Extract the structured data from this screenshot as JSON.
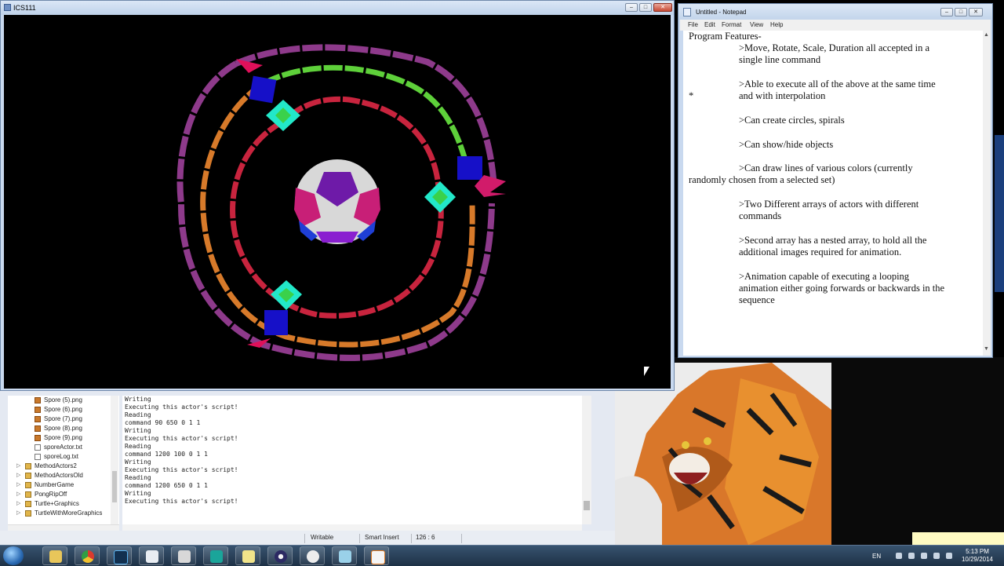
{
  "ics_window": {
    "title": "ICS111"
  },
  "notepad": {
    "title": "Untitled - Notepad",
    "menu": [
      "File",
      "Edit",
      "Format",
      "View",
      "Help"
    ],
    "lines": [
      "Program Features-",
      ">Move, Rotate, Scale, Duration all accepted in a",
      "single line command",
      ">Able to execute all of the above at the same time",
      "*",
      "and with interpolation",
      ">Can create circles, spirals",
      ">Can show/hide objects",
      ">Can draw lines of various colors (currently",
      "randomly chosen from a selected set)",
      ">Two Different arrays of actors with different",
      "commands",
      ">Second array has a nested array, to hold all the",
      "additional images required for animation.",
      ">Animation capable of executing a looping",
      "animation either going forwards or backwards in the",
      "sequence"
    ]
  },
  "package_explorer": {
    "items": [
      {
        "label": "Spore (5).png",
        "icon": "image-file-icon"
      },
      {
        "label": "Spore (6).png",
        "icon": "image-file-icon"
      },
      {
        "label": "Spore (7).png",
        "icon": "image-file-icon"
      },
      {
        "label": "Spore (8).png",
        "icon": "image-file-icon"
      },
      {
        "label": "Spore (9).png",
        "icon": "image-file-icon"
      },
      {
        "label": "sporeActor.txt",
        "icon": "text-file-icon"
      },
      {
        "label": "sporeLog.txt",
        "icon": "text-file-icon"
      },
      {
        "label": "MethodActors2",
        "icon": "project-icon"
      },
      {
        "label": "MethodActorsOld",
        "icon": "project-icon"
      },
      {
        "label": "NumberGame",
        "icon": "project-icon"
      },
      {
        "label": "PongRipOff",
        "icon": "project-icon"
      },
      {
        "label": "Turtle+Graphics",
        "icon": "project-icon"
      },
      {
        "label": "TurtleWithMoreGraphics",
        "icon": "project-icon"
      }
    ]
  },
  "console": {
    "lines": [
      "Writing",
      "Executing this actor's script!",
      "Reading",
      "command 90 650 0 1 1",
      "Writing",
      "Executing this actor's script!",
      "Reading",
      "command 1200 100 0 1 1",
      "Writing",
      "Executing this actor's script!",
      "Reading",
      "command 1200 650 0 1 1",
      "Writing",
      "Executing this actor's script!"
    ]
  },
  "status_bar": {
    "mode": "Writable",
    "insert": "Smart Insert",
    "position": "126 : 6"
  },
  "taskbar": {
    "apps": [
      "explorer",
      "chrome",
      "photoshop",
      "unity",
      "zbrush",
      "maya",
      "folder",
      "eclipse",
      "blender",
      "file",
      "java"
    ],
    "language": "EN",
    "time": "5:13 PM",
    "date": "10/29/2014"
  },
  "colors": {
    "canvas_bg": "#000000",
    "purple_path": "#8e3a8b",
    "green_path": "#5ed03a",
    "orange_path": "#d77a2a",
    "red_path": "#c8243e"
  }
}
